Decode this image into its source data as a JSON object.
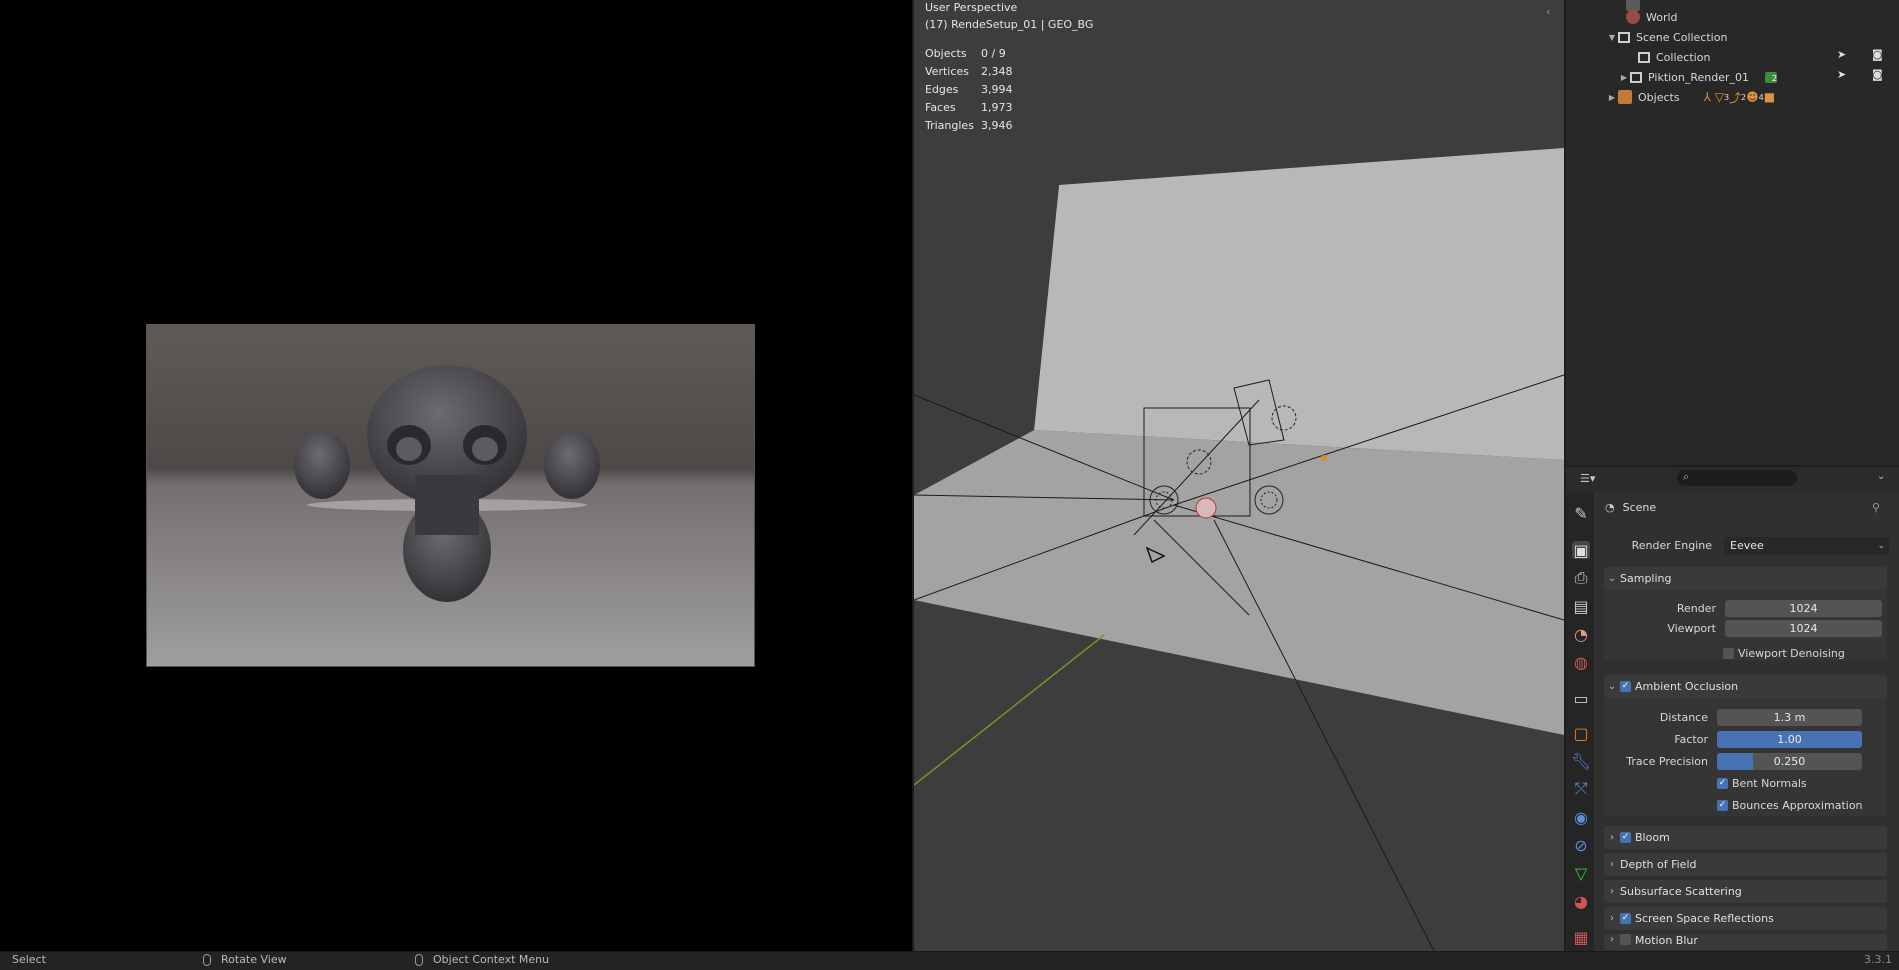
{
  "viewport": {
    "perspective": "User Perspective",
    "context": "(17) RendeSetup_01 | GEO_BG",
    "stats": [
      {
        "label": "Objects",
        "value": "0 / 9"
      },
      {
        "label": "Vertices",
        "value": "2,348"
      },
      {
        "label": "Edges",
        "value": "3,994"
      },
      {
        "label": "Faces",
        "value": "1,973"
      },
      {
        "label": "Triangles",
        "value": "3,946"
      }
    ]
  },
  "outliner": {
    "items": {
      "world": "World",
      "scene_collection": "Scene Collection",
      "collection": "Collection",
      "render_collection": "Piktion_Render_01",
      "render_collection_badge": "2",
      "objects": "Objects",
      "objects_counts": [
        "3",
        "2",
        "4"
      ]
    }
  },
  "properties": {
    "context_label": "Scene",
    "render_engine": {
      "label": "Render Engine",
      "value": "Eevee"
    },
    "sampling": {
      "title": "Sampling",
      "render_label": "Render",
      "render_value": "1024",
      "viewport_label": "Viewport",
      "viewport_value": "1024",
      "denoise_label": "Viewport Denoising"
    },
    "ao": {
      "title": "Ambient Occlusion",
      "distance_label": "Distance",
      "distance_value": "1.3 m",
      "factor_label": "Factor",
      "factor_value": "1.00",
      "factor_fill": 1.0,
      "trace_label": "Trace Precision",
      "trace_value": "0.250",
      "trace_fill": 0.25,
      "bent_label": "Bent Normals",
      "bounces_label": "Bounces Approximation"
    },
    "panels": {
      "bloom": "Bloom",
      "dof": "Depth of Field",
      "sss": "Subsurface Scattering",
      "ssr": "Screen Space Reflections",
      "motion_blur": "Motion Blur"
    }
  },
  "status_bar": {
    "select": "Select",
    "rotate": "Rotate View",
    "context_menu": "Object Context Menu",
    "version": "3.3.1"
  },
  "colors": {
    "accent": "#4772b3",
    "bg": "#1d1d1d",
    "viewport": "#3d3d3d"
  }
}
